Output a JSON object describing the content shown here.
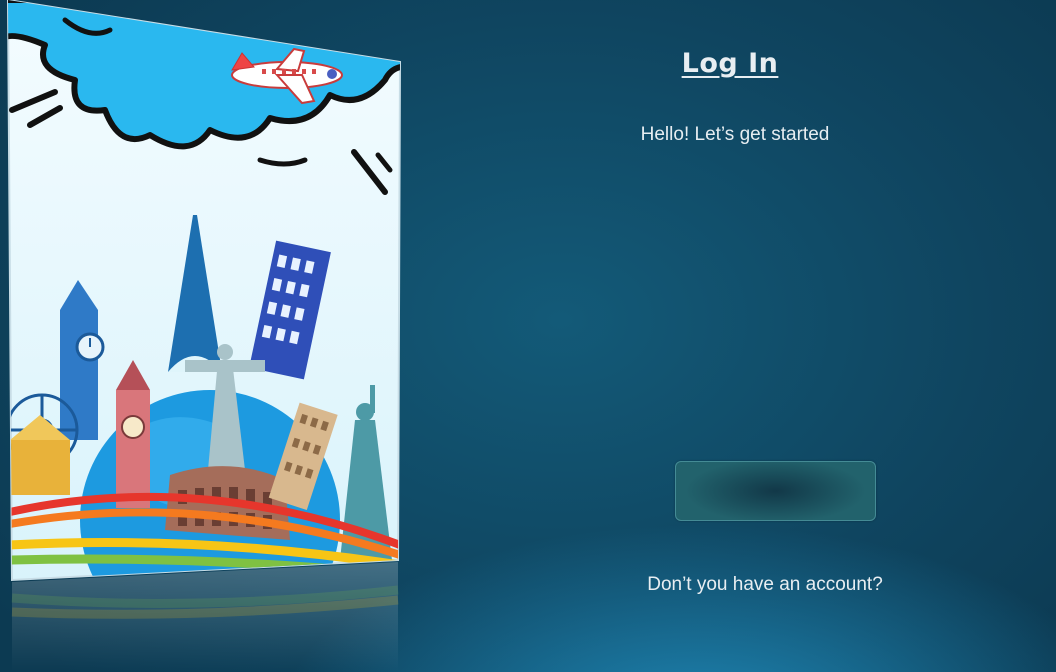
{
  "login": {
    "title": "Log In",
    "subtitle": "Hello! Let’s get started",
    "signup_prompt": "Don’t you have an account?"
  },
  "poster": {
    "icons": [
      "cloud-icon",
      "airplane-icon",
      "eiffel-tower-icon",
      "big-ben-icon",
      "leaning-tower-icon",
      "colosseum-icon",
      "statue-of-liberty-icon",
      "ferris-wheel-icon",
      "globe-icon",
      "christ-redeemer-icon"
    ]
  },
  "colors": {
    "background": "#0f4560",
    "text": "#e8eef2",
    "sky": "#2ab8ef",
    "accent_red": "#e6362c",
    "accent_yellow": "#f7c515"
  }
}
